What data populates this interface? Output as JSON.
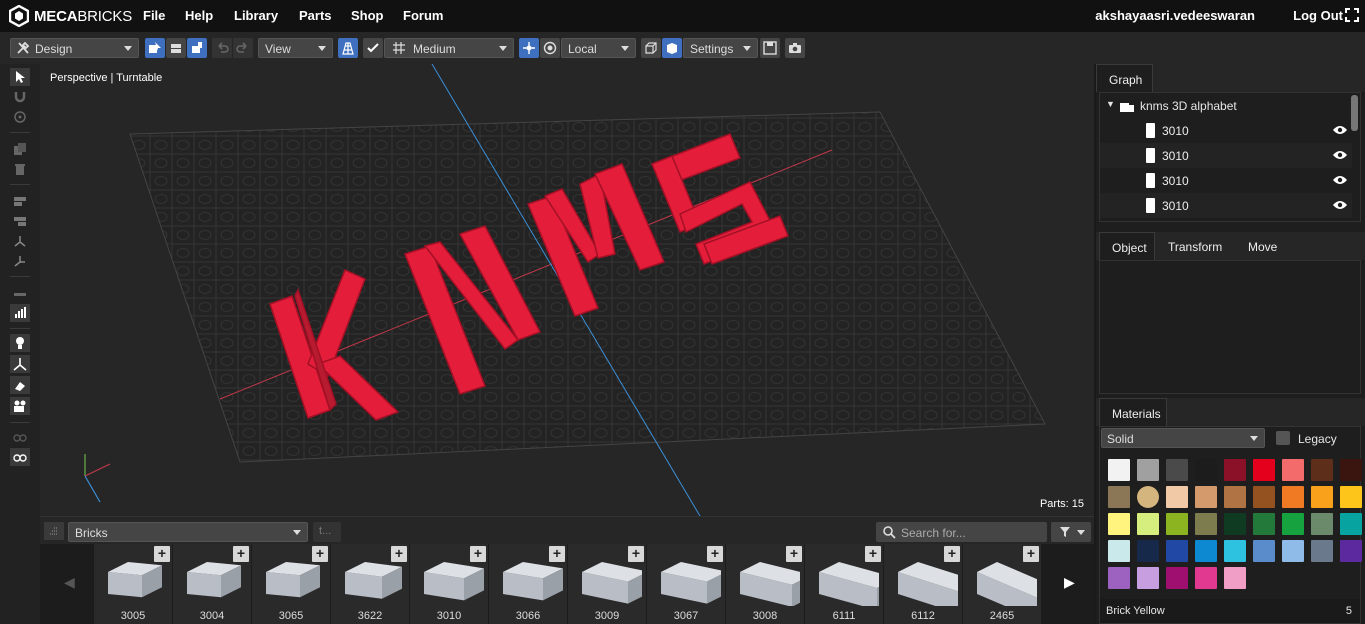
{
  "app": {
    "brand_bold": "MECA",
    "brand_light": "BRICKS"
  },
  "nav": {
    "menus": [
      "File",
      "Help",
      "Library",
      "Parts",
      "Shop",
      "Forum"
    ],
    "username": "akshayaasri.vedeeswaran",
    "logout": "Log Out"
  },
  "toolbar": {
    "mode": "Design",
    "view": "View",
    "quality": "Medium",
    "space": "Local",
    "settings": "Settings"
  },
  "viewport": {
    "label": "Perspective | Turntable",
    "parts_count": "Parts: 15",
    "model_letters": [
      "K",
      "N",
      "M",
      "5"
    ]
  },
  "bottom": {
    "category": "Bricks",
    "back_label": "t...",
    "search_placeholder": "Search for...",
    "parts": [
      "3005",
      "3004",
      "3065",
      "3622",
      "3010",
      "3066",
      "3009",
      "3067",
      "3008",
      "6111",
      "6112",
      "2465"
    ]
  },
  "graph": {
    "tab": "Graph",
    "root": "knms 3D alphabet",
    "items": [
      "3010",
      "3010",
      "3010",
      "3010"
    ]
  },
  "object_tabs": [
    "Object",
    "Transform",
    "Move"
  ],
  "materials": {
    "tab": "Materials",
    "type": "Solid",
    "legacy": "Legacy",
    "selected_name": "Brick Yellow",
    "selected_count": "5",
    "colors": [
      "#f2f2f2",
      "#a0a0a0",
      "#4a4a4a",
      "#1c1c1c",
      "#8a1128",
      "#e4001c",
      "#f36b6b",
      "#5d2e1a",
      "#3a1510",
      "#8b7655",
      "#d4b57e",
      "#f2c9a6",
      "#d59a6c",
      "#b07344",
      "#93521f",
      "#f07a24",
      "#f9a11b",
      "#fdc41a",
      "#fff47e",
      "#d6ee7e",
      "#8cb320",
      "#7c7c4e",
      "#0e3b22",
      "#237939",
      "#16a23f",
      "#6b8a6b",
      "#06a3a1",
      "#c9e9ea",
      "#16294a",
      "#2248a6",
      "#0c89d0",
      "#2dc3e0",
      "#5a8ccc",
      "#8ebbe8",
      "#6a7a8c",
      "#5c2a9e",
      "#9d61c0",
      "#c79ee0",
      "#9e0f6f",
      "#e0398f",
      "#f09ec6"
    ]
  }
}
